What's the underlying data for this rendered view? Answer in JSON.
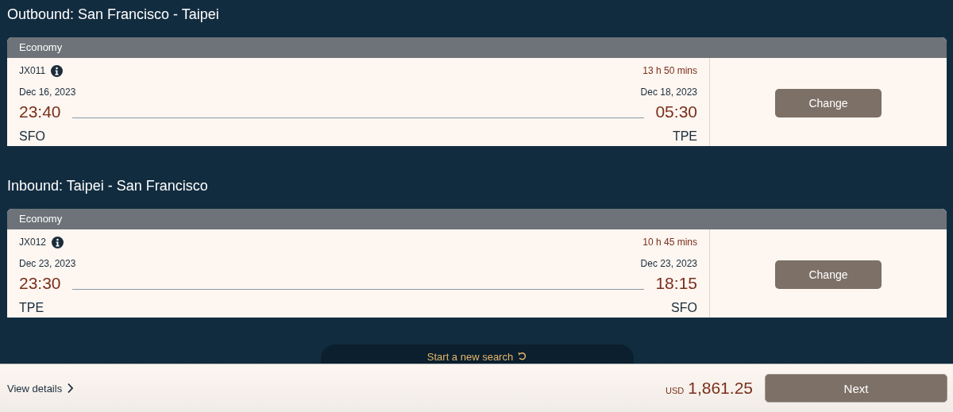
{
  "legs": [
    {
      "title": "Outbound: San Francisco - Taipei",
      "cabin": "Economy",
      "flight_number": "JX011",
      "duration": "13 h 50 mins",
      "depart_date": "Dec 16, 2023",
      "arrive_date": "Dec 18, 2023",
      "depart_time": "23:40",
      "arrive_time": "05:30",
      "origin": "SFO",
      "destination": "TPE",
      "button": "Change"
    },
    {
      "title": "Inbound: Taipei - San Francisco",
      "cabin": "Economy",
      "flight_number": "JX012",
      "duration": "10 h 45 mins",
      "depart_date": "Dec 23, 2023",
      "arrive_date": "Dec 23, 2023",
      "depart_time": "23:30",
      "arrive_time": "18:15",
      "origin": "TPE",
      "destination": "SFO",
      "button": "Change"
    }
  ],
  "new_search": "Start a new search",
  "footer": {
    "details_link": "View details",
    "currency": "USD",
    "total": "1,861.25",
    "next_button": "Next"
  }
}
